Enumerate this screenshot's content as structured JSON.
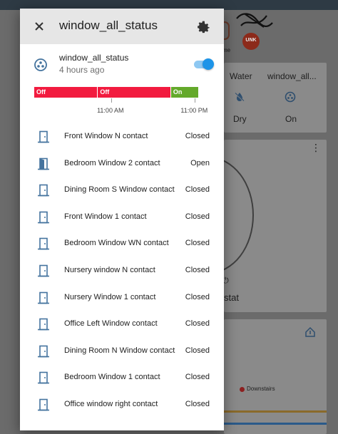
{
  "dialog": {
    "title": "window_all_status",
    "entity_name": "window_all_status",
    "last_changed": "4 hours ago",
    "toggle_on": true
  },
  "history": {
    "segments": [
      {
        "label": "Off",
        "color": "#f21b3f",
        "start": 0.0,
        "end": 0.384
      },
      {
        "label": "Off",
        "color": "#f21b3f",
        "start": 0.384,
        "end": 0.83
      },
      {
        "label": "On",
        "color": "#64a92b",
        "start": 0.83,
        "end": 1.0
      }
    ],
    "ticks": [
      {
        "label": "11:00 AM",
        "pos": 0.47
      },
      {
        "label": "11:00 PM",
        "pos": 0.98
      }
    ]
  },
  "contacts": [
    {
      "name": "Front Window N contact",
      "state": "Closed",
      "open": false
    },
    {
      "name": "Bedroom Window 2 contact",
      "state": "Open",
      "open": true
    },
    {
      "name": "Dining Room S Window contact",
      "state": "Closed",
      "open": false
    },
    {
      "name": "Front Window 1 contact",
      "state": "Closed",
      "open": false
    },
    {
      "name": "Bedroom Window WN contact",
      "state": "Closed",
      "open": false
    },
    {
      "name": "Nursery window N contact",
      "state": "Closed",
      "open": false
    },
    {
      "name": "Nursery Window 1 contact",
      "state": "Closed",
      "open": false
    },
    {
      "name": "Office Left Window contact",
      "state": "Closed",
      "open": false
    },
    {
      "name": "Dining Room N Window contact",
      "state": "Closed",
      "open": false
    },
    {
      "name": "Bedroom Window 1 contact",
      "state": "Closed",
      "open": false
    },
    {
      "name": "Office window right contact",
      "state": "Closed",
      "open": false
    }
  ],
  "background": {
    "badge_text": "UNK",
    "badge_caption": "me",
    "water_label": "Water",
    "water_state": "Dry",
    "window_label": "window_all...",
    "window_state": "On",
    "thermostat_label": "stat",
    "legend_label": "Downstairs"
  },
  "colors": {
    "accent": "#1d94e8",
    "icon": "#44739e",
    "header_bg": "#e6e6e6"
  }
}
